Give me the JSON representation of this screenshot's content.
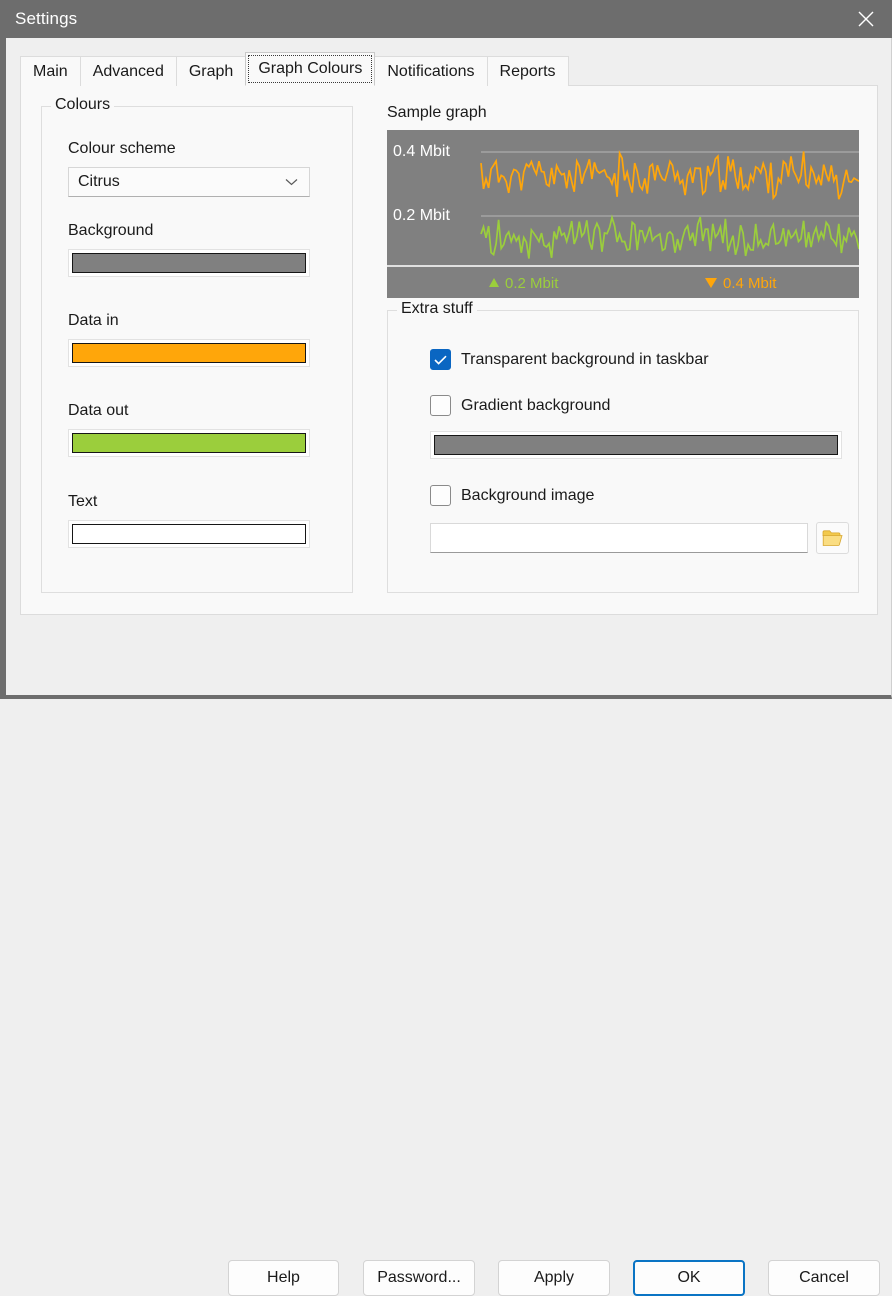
{
  "window": {
    "title": "Settings",
    "close_icon": "close-icon"
  },
  "tabs": [
    {
      "label": "Main",
      "selected": false
    },
    {
      "label": "Advanced",
      "selected": false
    },
    {
      "label": "Graph",
      "selected": false
    },
    {
      "label": "Graph Colours",
      "selected": true
    },
    {
      "label": "Notifications",
      "selected": false
    },
    {
      "label": "Reports",
      "selected": false
    }
  ],
  "colours_group": {
    "legend": "Colours",
    "scheme_label": "Colour scheme",
    "scheme_value": "Citrus",
    "scheme_chevron_icon": "chevron-down-icon",
    "background_label": "Background",
    "background_colour": "#808080",
    "data_in_label": "Data in",
    "data_in_colour": "#FFA60A",
    "data_out_label": "Data out",
    "data_out_colour": "#9BCE3C",
    "text_label": "Text",
    "text_colour": "#FFFFFF"
  },
  "sample_graph": {
    "title": "Sample graph",
    "background_colour": "#808080",
    "axis_label_top": "0.4 Mbit",
    "axis_label_bottom": "0.2 Mbit",
    "axis_label_colour": "#FFFFFF",
    "legend_in": "0.2 Mbit",
    "legend_in_icon": "triangle-up-icon",
    "legend_in_colour": "#9BCE3C",
    "legend_out": "0.4 Mbit",
    "legend_out_icon": "triangle-down-icon",
    "legend_out_colour": "#FFA60A"
  },
  "extra_group": {
    "legend": "Extra stuff",
    "transparent_label": "Transparent background in taskbar",
    "transparent_checked": true,
    "gradient_label": "Gradient background",
    "gradient_checked": false,
    "gradient_colour": "#808080",
    "bgimage_label": "Background image",
    "bgimage_checked": false,
    "bgimage_path": "",
    "bgimage_placeholder": "",
    "browse_icon": "folder-icon"
  },
  "footer": {
    "help": "Help",
    "password": "Password...",
    "apply": "Apply",
    "ok": "OK",
    "cancel": "Cancel"
  },
  "chart_data": {
    "type": "line",
    "title": "Sample graph",
    "ylabel": "",
    "xlabel": "",
    "ytick_labels": [
      "0.4 Mbit",
      "0.2 Mbit"
    ],
    "grid": true,
    "legend_position": "bottom",
    "series": [
      {
        "name": "Data in (0.4 Mbit)",
        "colour": "#FFA60A",
        "noise_seed": 11,
        "baseline": 0.26,
        "amplitude": 0.12
      },
      {
        "name": "Data out (0.2 Mbit)",
        "colour": "#9BCE3C",
        "noise_seed": 29,
        "baseline": 0.24,
        "amplitude": 0.11
      }
    ]
  }
}
